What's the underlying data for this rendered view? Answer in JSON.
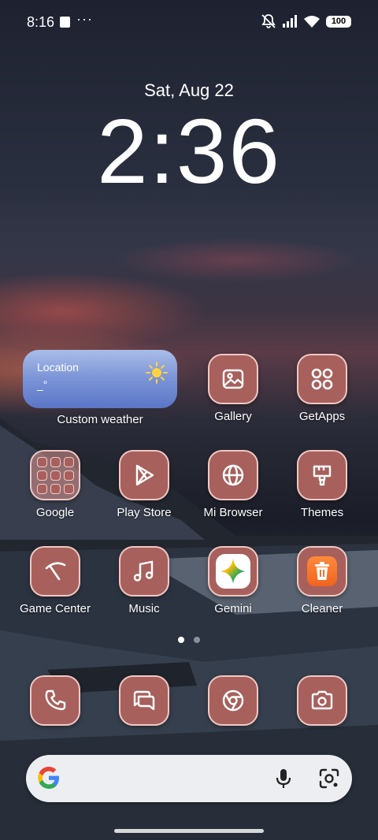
{
  "status_bar": {
    "time": "8:16",
    "more": "···",
    "battery": "100",
    "icons": [
      "notification-square-icon",
      "mute-bell-icon",
      "signal-icon",
      "wifi-icon",
      "battery-icon"
    ]
  },
  "lockclock": {
    "date": "Sat, Aug 22",
    "time": "2:36"
  },
  "weather_widget": {
    "location": "Location",
    "temp_placeholder": "_°",
    "label": "Custom weather",
    "icon": "sun-icon"
  },
  "apps_row1": [
    {
      "label": "Gallery",
      "icon": "gallery-icon"
    },
    {
      "label": "GetApps",
      "icon": "getapps-icon"
    }
  ],
  "apps_row2": [
    {
      "label": "Google",
      "icon": "folder-icon"
    },
    {
      "label": "Play Store",
      "icon": "play-store-icon"
    },
    {
      "label": "Mi Browser",
      "icon": "globe-icon"
    },
    {
      "label": "Themes",
      "icon": "brush-icon"
    }
  ],
  "apps_row3": [
    {
      "label": "Game Center",
      "icon": "game-center-icon"
    },
    {
      "label": "Music",
      "icon": "music-note-icon"
    },
    {
      "label": "Gemini",
      "icon": "gemini-icon"
    },
    {
      "label": "Cleaner",
      "icon": "trash-icon"
    }
  ],
  "dock": [
    {
      "icon": "phone-icon"
    },
    {
      "icon": "messages-icon"
    },
    {
      "icon": "chrome-icon"
    },
    {
      "icon": "camera-icon"
    }
  ],
  "page_indicator": {
    "count": 2,
    "active": 0
  },
  "search_bar": {
    "icons": [
      "google-g-icon",
      "mic-icon",
      "lens-icon"
    ]
  },
  "colors": {
    "icon_bg": "#a8605c",
    "icon_border": "#f0c9c4",
    "weather_top": "#a9bde8",
    "weather_bottom": "#5b76c7"
  }
}
